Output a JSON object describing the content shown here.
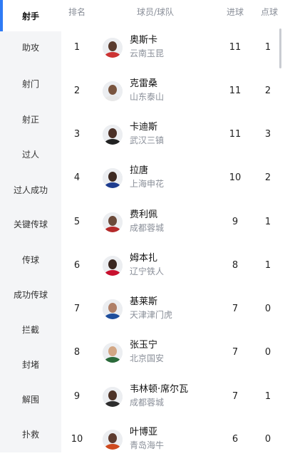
{
  "sidebar": {
    "items": [
      {
        "label": "射手",
        "active": true
      },
      {
        "label": "助攻"
      },
      {
        "label": "射门"
      },
      {
        "label": "射正"
      },
      {
        "label": "过人"
      },
      {
        "label": "过人成功"
      },
      {
        "label": "关键传球"
      },
      {
        "label": "传球"
      },
      {
        "label": "成功传球"
      },
      {
        "label": "拦截"
      },
      {
        "label": "封堵"
      },
      {
        "label": "解围"
      },
      {
        "label": "扑救"
      }
    ]
  },
  "table": {
    "headers": {
      "rank": "排名",
      "player": "球员/球队",
      "goals": "进球",
      "pens": "点球"
    },
    "rows": [
      {
        "rank": "1",
        "name": "奥斯卡",
        "team": "云南玉昆",
        "goals": "11",
        "pens": "1"
      },
      {
        "rank": "2",
        "name": "克雷桑",
        "team": "山东泰山",
        "goals": "11",
        "pens": "2"
      },
      {
        "rank": "3",
        "name": "卡迪斯",
        "team": "武汉三镇",
        "goals": "11",
        "pens": "3"
      },
      {
        "rank": "4",
        "name": "拉唐",
        "team": "上海申花",
        "goals": "10",
        "pens": "2"
      },
      {
        "rank": "5",
        "name": "费利佩",
        "team": "成都蓉城",
        "goals": "9",
        "pens": "1"
      },
      {
        "rank": "6",
        "name": "姆本扎",
        "team": "辽宁铁人",
        "goals": "8",
        "pens": "1"
      },
      {
        "rank": "7",
        "name": "基莱斯",
        "team": "天津津门虎",
        "goals": "7",
        "pens": "0"
      },
      {
        "rank": "8",
        "name": "张玉宁",
        "team": "北京国安",
        "goals": "7",
        "pens": "0"
      },
      {
        "rank": "9",
        "name": "韦林顿·席尔瓦",
        "team": "成都蓉城",
        "goals": "7",
        "pens": "1"
      },
      {
        "rank": "10",
        "name": "叶博亚",
        "team": "青岛海牛",
        "goals": "6",
        "pens": "0"
      }
    ]
  },
  "colors": {
    "accent": "#2f7bf5",
    "sidebar_bg": "#f4f5f7",
    "muted": "#8a8f99"
  }
}
